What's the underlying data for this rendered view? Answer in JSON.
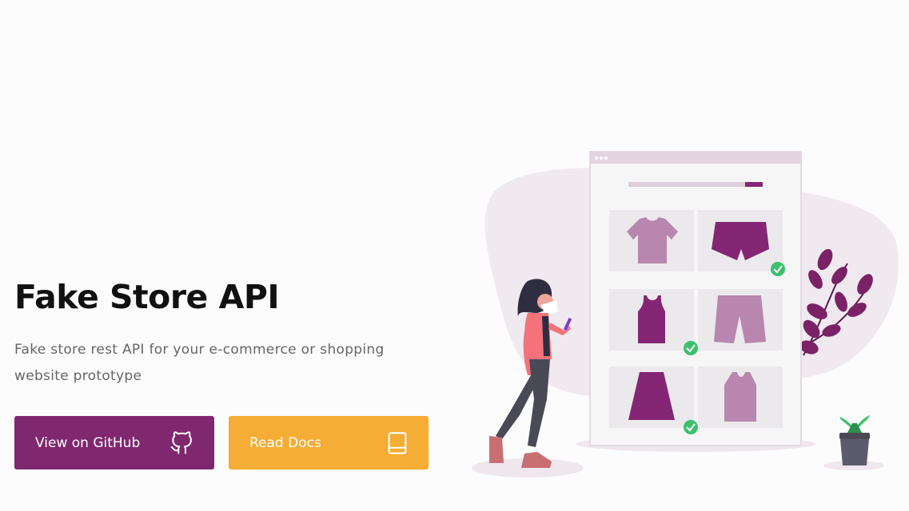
{
  "hero": {
    "title": "Fake Store API",
    "description": "Fake store rest API for your e-commerce or shopping website prototype"
  },
  "buttons": {
    "github_label": "View on GitHub",
    "docs_label": "Read Docs"
  },
  "colors": {
    "primary": "#80286f",
    "secondary": "#f5ad35",
    "product_dark": "#842673",
    "product_light": "#b886ae",
    "check": "#3bc16c"
  },
  "icons": {
    "github": "github-icon",
    "docs": "book-icon",
    "check": "check-icon"
  }
}
